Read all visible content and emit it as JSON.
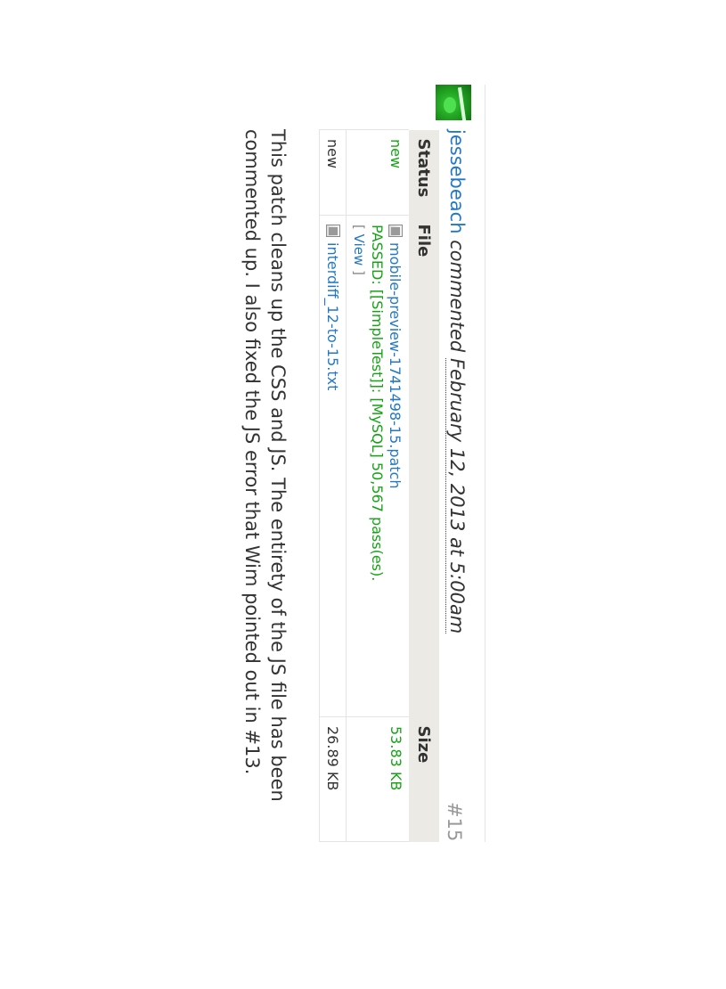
{
  "comment": {
    "author": "jessebeach",
    "verb": "commented",
    "date": "February 12, 2013 at 5:00am",
    "permalink": "#15",
    "body": "This patch cleans up the CSS and JS. The entirety of the JS file has been commented up. I also fixed the JS error that Wim pointed out in #13."
  },
  "files_table": {
    "headers": {
      "status": "Status",
      "file": "File",
      "size": "Size"
    },
    "rows": [
      {
        "status": "new",
        "file_name": "mobile-preview-1741498-15.patch",
        "test_result": "PASSED: [[SimpleTest]]: [MySQL] 50,567 pass(es).",
        "view_open": "[",
        "view_label": "View",
        "view_close": "]",
        "size": "53.83 KB"
      },
      {
        "status": "new",
        "file_name": "interdiff_12-to-15.txt",
        "size": "26.89 KB"
      }
    ]
  },
  "colors": {
    "link": "#2278c4",
    "pass": "#15a315",
    "header_bg": "#ebeae4",
    "muted": "#999999"
  },
  "icons": [
    "user-avatar",
    "file-icon"
  ]
}
